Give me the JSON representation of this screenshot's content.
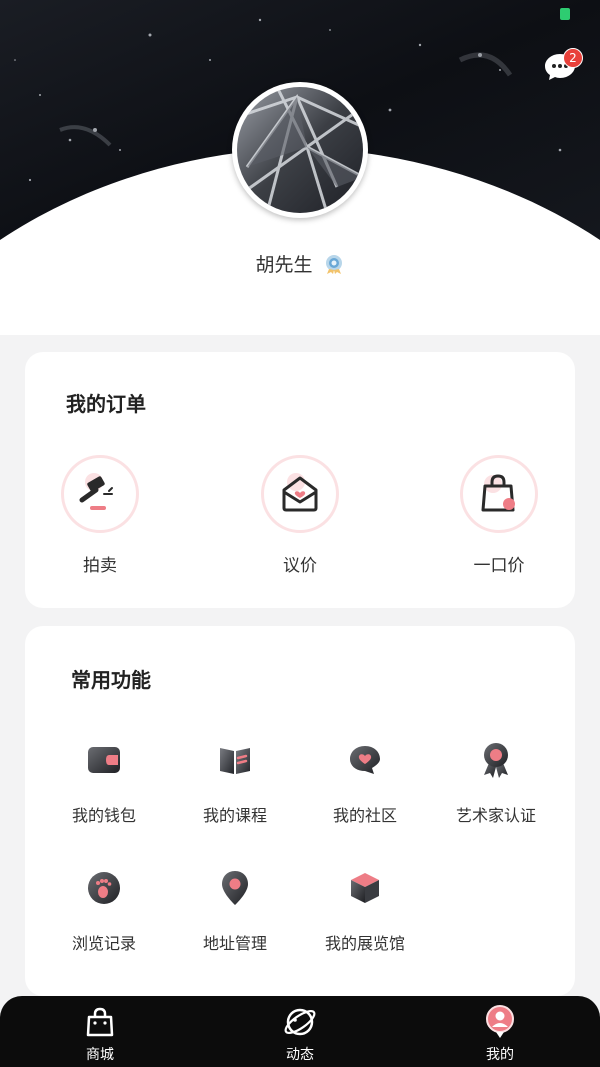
{
  "header": {
    "message_badge_count": "2",
    "username": "胡先生",
    "icons": {
      "message": "chat-bubble-icon",
      "verified": "verified-badge-icon"
    }
  },
  "orders": {
    "title": "我的订单",
    "items": [
      {
        "label": "拍卖",
        "icon": "auction-hammer-icon"
      },
      {
        "label": "议价",
        "icon": "envelope-heart-icon"
      },
      {
        "label": "一口价",
        "icon": "shopping-bag-icon"
      }
    ]
  },
  "functions": {
    "title": "常用功能",
    "items": [
      {
        "label": "我的钱包",
        "icon": "wallet-icon"
      },
      {
        "label": "我的课程",
        "icon": "book-icon"
      },
      {
        "label": "我的社区",
        "icon": "community-heart-icon"
      },
      {
        "label": "艺术家认证",
        "icon": "award-medal-icon"
      },
      {
        "label": "浏览记录",
        "icon": "footprint-icon"
      },
      {
        "label": "地址管理",
        "icon": "location-pin-icon"
      },
      {
        "label": "我的展览馆",
        "icon": "cube-icon"
      }
    ]
  },
  "tabbar": {
    "items": [
      {
        "label": "商城",
        "icon": "shopping-bag-icon",
        "active": false
      },
      {
        "label": "动态",
        "icon": "planet-icon",
        "active": false
      },
      {
        "label": "我的",
        "icon": "profile-icon",
        "active": true
      }
    ]
  },
  "colors": {
    "accent": "#ee7d86",
    "accent_light": "#fbe1e3",
    "tabbar_bg": "#0c0c0c",
    "page_bg": "#f3f3f4"
  }
}
